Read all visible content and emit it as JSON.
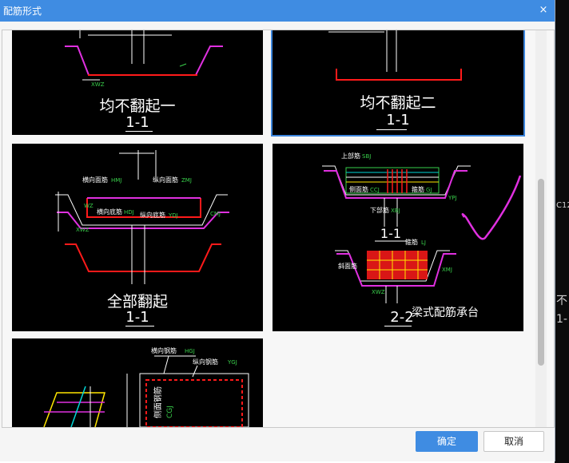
{
  "dialog": {
    "title": "配筋形式",
    "close_glyph": "×"
  },
  "options": [
    {
      "caption": "均不翻起一",
      "sub": "1-1",
      "labels": [
        "XWZ"
      ]
    },
    {
      "caption": "均不翻起二",
      "sub": "1-1",
      "labels": []
    },
    {
      "caption": "全部翻起",
      "sub": "1-1",
      "labels": [
        "横向面筋",
        "HMJ",
        "纵向面筋",
        "ZMJ",
        "横向底筋",
        "HDJ",
        "纵向底筋",
        "YDJ",
        "CMJ",
        "XWZ",
        "WZ"
      ]
    },
    {
      "caption": "梁式配筋承台",
      "sub": "2-2",
      "section_label": "1-1",
      "labels": [
        "上部筋",
        "SBJ",
        "侧面筋",
        "CCJ",
        "箍筋",
        "GJ",
        "下部筋",
        "XBJ",
        "箍筋",
        "LJ",
        "斜面筋",
        "XMJ",
        "XWZ",
        "YPJ"
      ]
    },
    {
      "caption": "",
      "sub": "",
      "labels": [
        "横向钢筋",
        "HGJ",
        "纵向钢筋",
        "YGJ",
        "侧面钢筋",
        "CGJ"
      ]
    }
  ],
  "footer": {
    "ok_label": "确定",
    "cancel_label": "取消"
  },
  "background": {
    "right_texts": [
      "C12",
      "不",
      "1-"
    ]
  },
  "colors": {
    "accent": "#3f8ce2",
    "selection": "#3c85dc",
    "tile_bg": "#000000",
    "rebar_red": "#ff1a1a",
    "magenta": "#e030e0"
  }
}
